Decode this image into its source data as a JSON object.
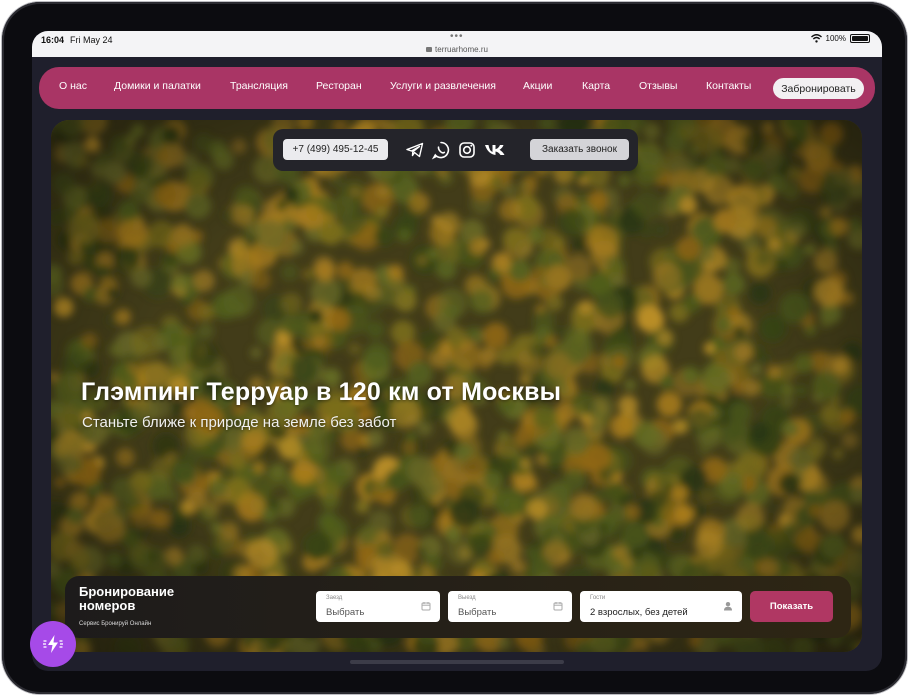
{
  "status": {
    "time": "16:04",
    "date": "Fri May 24",
    "url": "terruarhome.ru",
    "battery": "100%"
  },
  "nav": {
    "items": [
      "О нас",
      "Домики и палатки",
      "Трансляция",
      "Ресторан",
      "Услуги и развлечения",
      "Акции",
      "Карта",
      "Отзывы",
      "Контакты"
    ],
    "book_label": "Забронировать"
  },
  "contacts": {
    "phone": "+7 (499) 495-12-45",
    "icons": [
      "telegram-icon",
      "whatsapp-icon",
      "instagram-icon",
      "vk-icon"
    ],
    "call_label": "Заказать звонок"
  },
  "hero": {
    "title": "Глэмпинг Терруар в 120 км от Москвы",
    "subtitle": "Станьте ближе к природе на земле без забот"
  },
  "booking": {
    "title": "Бронирование номеров",
    "service": "Сервис Бронируй Онлайн",
    "checkin": {
      "label": "Заезд",
      "value": "Выбрать"
    },
    "checkout": {
      "label": "Выезд",
      "value": "Выбрать"
    },
    "guests": {
      "label": "Гости",
      "value": "2 взрослых, без детей"
    },
    "show_label": "Показать"
  },
  "colors": {
    "nav_bg": "#a93565",
    "accent": "#b03763",
    "fab": "#a64ae8"
  }
}
